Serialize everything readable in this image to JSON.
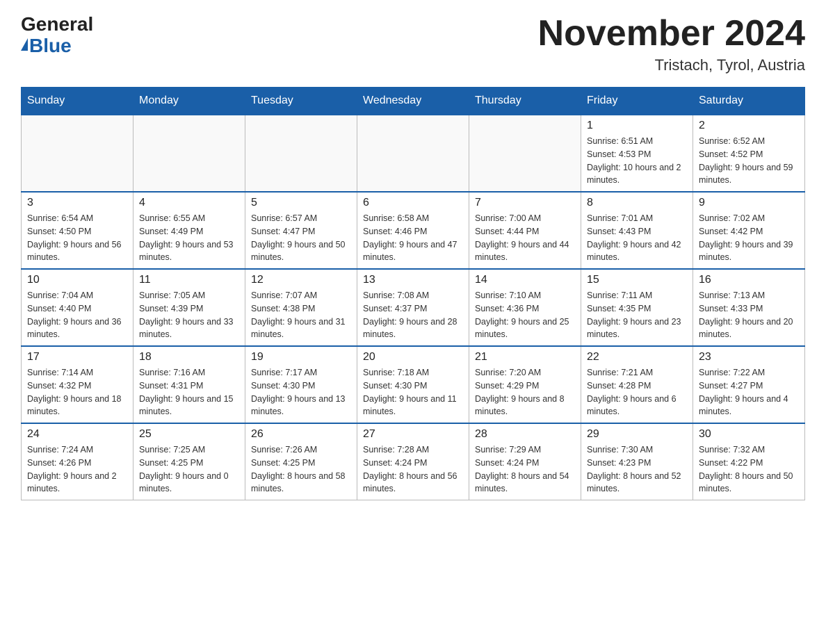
{
  "header": {
    "logo_general": "General",
    "logo_blue": "Blue",
    "month_title": "November 2024",
    "location": "Tristach, Tyrol, Austria"
  },
  "days_of_week": [
    "Sunday",
    "Monday",
    "Tuesday",
    "Wednesday",
    "Thursday",
    "Friday",
    "Saturday"
  ],
  "weeks": [
    [
      {
        "day": "",
        "info": ""
      },
      {
        "day": "",
        "info": ""
      },
      {
        "day": "",
        "info": ""
      },
      {
        "day": "",
        "info": ""
      },
      {
        "day": "",
        "info": ""
      },
      {
        "day": "1",
        "info": "Sunrise: 6:51 AM\nSunset: 4:53 PM\nDaylight: 10 hours and 2 minutes."
      },
      {
        "day": "2",
        "info": "Sunrise: 6:52 AM\nSunset: 4:52 PM\nDaylight: 9 hours and 59 minutes."
      }
    ],
    [
      {
        "day": "3",
        "info": "Sunrise: 6:54 AM\nSunset: 4:50 PM\nDaylight: 9 hours and 56 minutes."
      },
      {
        "day": "4",
        "info": "Sunrise: 6:55 AM\nSunset: 4:49 PM\nDaylight: 9 hours and 53 minutes."
      },
      {
        "day": "5",
        "info": "Sunrise: 6:57 AM\nSunset: 4:47 PM\nDaylight: 9 hours and 50 minutes."
      },
      {
        "day": "6",
        "info": "Sunrise: 6:58 AM\nSunset: 4:46 PM\nDaylight: 9 hours and 47 minutes."
      },
      {
        "day": "7",
        "info": "Sunrise: 7:00 AM\nSunset: 4:44 PM\nDaylight: 9 hours and 44 minutes."
      },
      {
        "day": "8",
        "info": "Sunrise: 7:01 AM\nSunset: 4:43 PM\nDaylight: 9 hours and 42 minutes."
      },
      {
        "day": "9",
        "info": "Sunrise: 7:02 AM\nSunset: 4:42 PM\nDaylight: 9 hours and 39 minutes."
      }
    ],
    [
      {
        "day": "10",
        "info": "Sunrise: 7:04 AM\nSunset: 4:40 PM\nDaylight: 9 hours and 36 minutes."
      },
      {
        "day": "11",
        "info": "Sunrise: 7:05 AM\nSunset: 4:39 PM\nDaylight: 9 hours and 33 minutes."
      },
      {
        "day": "12",
        "info": "Sunrise: 7:07 AM\nSunset: 4:38 PM\nDaylight: 9 hours and 31 minutes."
      },
      {
        "day": "13",
        "info": "Sunrise: 7:08 AM\nSunset: 4:37 PM\nDaylight: 9 hours and 28 minutes."
      },
      {
        "day": "14",
        "info": "Sunrise: 7:10 AM\nSunset: 4:36 PM\nDaylight: 9 hours and 25 minutes."
      },
      {
        "day": "15",
        "info": "Sunrise: 7:11 AM\nSunset: 4:35 PM\nDaylight: 9 hours and 23 minutes."
      },
      {
        "day": "16",
        "info": "Sunrise: 7:13 AM\nSunset: 4:33 PM\nDaylight: 9 hours and 20 minutes."
      }
    ],
    [
      {
        "day": "17",
        "info": "Sunrise: 7:14 AM\nSunset: 4:32 PM\nDaylight: 9 hours and 18 minutes."
      },
      {
        "day": "18",
        "info": "Sunrise: 7:16 AM\nSunset: 4:31 PM\nDaylight: 9 hours and 15 minutes."
      },
      {
        "day": "19",
        "info": "Sunrise: 7:17 AM\nSunset: 4:30 PM\nDaylight: 9 hours and 13 minutes."
      },
      {
        "day": "20",
        "info": "Sunrise: 7:18 AM\nSunset: 4:30 PM\nDaylight: 9 hours and 11 minutes."
      },
      {
        "day": "21",
        "info": "Sunrise: 7:20 AM\nSunset: 4:29 PM\nDaylight: 9 hours and 8 minutes."
      },
      {
        "day": "22",
        "info": "Sunrise: 7:21 AM\nSunset: 4:28 PM\nDaylight: 9 hours and 6 minutes."
      },
      {
        "day": "23",
        "info": "Sunrise: 7:22 AM\nSunset: 4:27 PM\nDaylight: 9 hours and 4 minutes."
      }
    ],
    [
      {
        "day": "24",
        "info": "Sunrise: 7:24 AM\nSunset: 4:26 PM\nDaylight: 9 hours and 2 minutes."
      },
      {
        "day": "25",
        "info": "Sunrise: 7:25 AM\nSunset: 4:25 PM\nDaylight: 9 hours and 0 minutes."
      },
      {
        "day": "26",
        "info": "Sunrise: 7:26 AM\nSunset: 4:25 PM\nDaylight: 8 hours and 58 minutes."
      },
      {
        "day": "27",
        "info": "Sunrise: 7:28 AM\nSunset: 4:24 PM\nDaylight: 8 hours and 56 minutes."
      },
      {
        "day": "28",
        "info": "Sunrise: 7:29 AM\nSunset: 4:24 PM\nDaylight: 8 hours and 54 minutes."
      },
      {
        "day": "29",
        "info": "Sunrise: 7:30 AM\nSunset: 4:23 PM\nDaylight: 8 hours and 52 minutes."
      },
      {
        "day": "30",
        "info": "Sunrise: 7:32 AM\nSunset: 4:22 PM\nDaylight: 8 hours and 50 minutes."
      }
    ]
  ]
}
